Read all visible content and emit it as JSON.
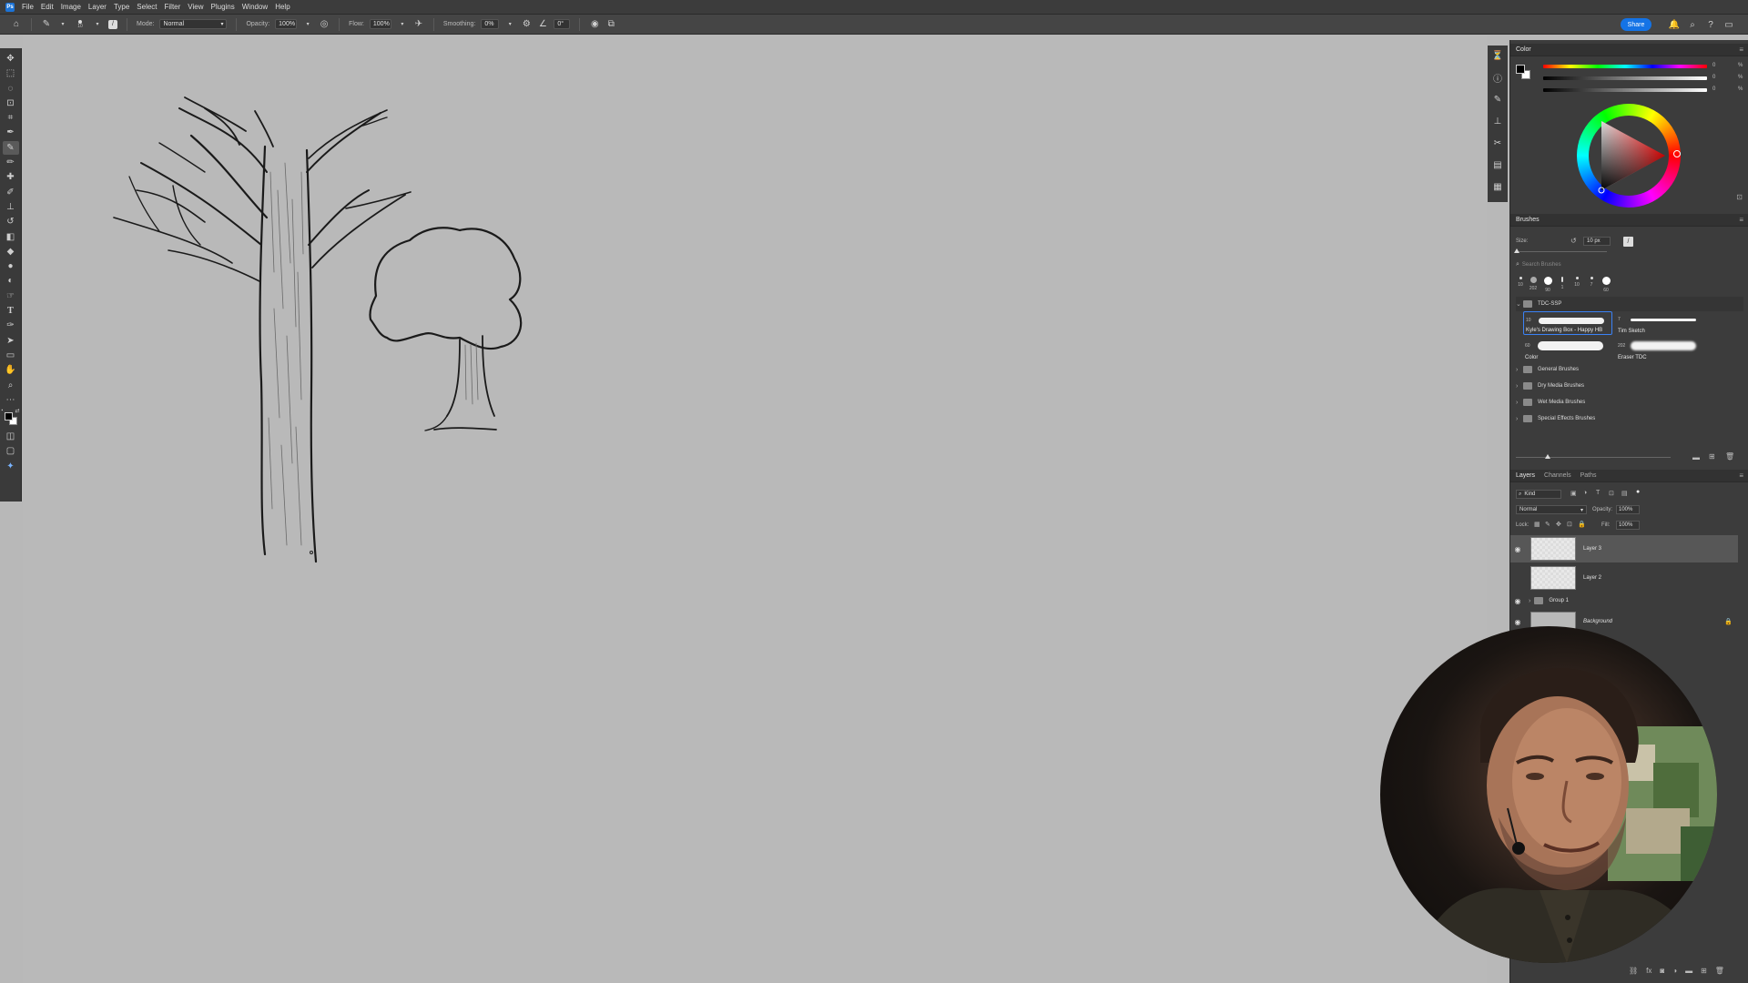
{
  "menubar": {
    "items": [
      "File",
      "Edit",
      "Image",
      "Layer",
      "Type",
      "Select",
      "Filter",
      "View",
      "Plugins",
      "Window",
      "Help"
    ]
  },
  "options": {
    "brush_size": "10",
    "mode_label": "Mode:",
    "mode_value": "Normal",
    "opacity_label": "Opacity:",
    "opacity_value": "100%",
    "flow_label": "Flow:",
    "flow_value": "100%",
    "smoothing_label": "Smoothing:",
    "smoothing_value": "0%",
    "angle_value": "0°",
    "share_label": "Share"
  },
  "color_panel": {
    "title": "Color",
    "r": "0",
    "g": "0",
    "b": "0",
    "unit": "%",
    "fg_color": "#000000",
    "bg_color": "#ffffff"
  },
  "brushes_panel": {
    "title": "Brushes",
    "size_label": "Size:",
    "size_value": "10 px",
    "search_placeholder": "Search Brushes",
    "recent_sizes": [
      "10",
      "202",
      "90",
      "1",
      "10",
      "7",
      "60"
    ],
    "set_name": "TDC-SSP",
    "brush_tiles": [
      {
        "size": "10",
        "name": "Kyle's Drawing Box - Happy HB"
      },
      {
        "size": "7",
        "name": "Tim Sketch"
      },
      {
        "size": "60",
        "name": "Color"
      },
      {
        "size": "202",
        "name": "Eraser TDC"
      }
    ],
    "folders": [
      "General Brushes",
      "Dry Media Brushes",
      "Wet Media Brushes",
      "Special Effects Brushes"
    ]
  },
  "layers_panel": {
    "tabs": [
      "Layers",
      "Channels",
      "Paths"
    ],
    "kind_label": "Kind",
    "blend_mode": "Normal",
    "opacity_label": "Opacity:",
    "opacity_value": "100%",
    "lock_label": "Lock:",
    "fill_label": "Fill:",
    "fill_value": "100%",
    "layers": [
      {
        "name": "Layer 3",
        "visible": true,
        "selected": true
      },
      {
        "name": "Layer 2",
        "visible": false,
        "selected": false
      },
      {
        "name": "Group 1",
        "visible": true,
        "selected": false
      },
      {
        "name": "Background",
        "visible": true,
        "selected": false
      }
    ]
  },
  "colors": {
    "accent": "#1473e6",
    "canvas": "#b9b9b9",
    "panel": "#3c3c3c"
  }
}
